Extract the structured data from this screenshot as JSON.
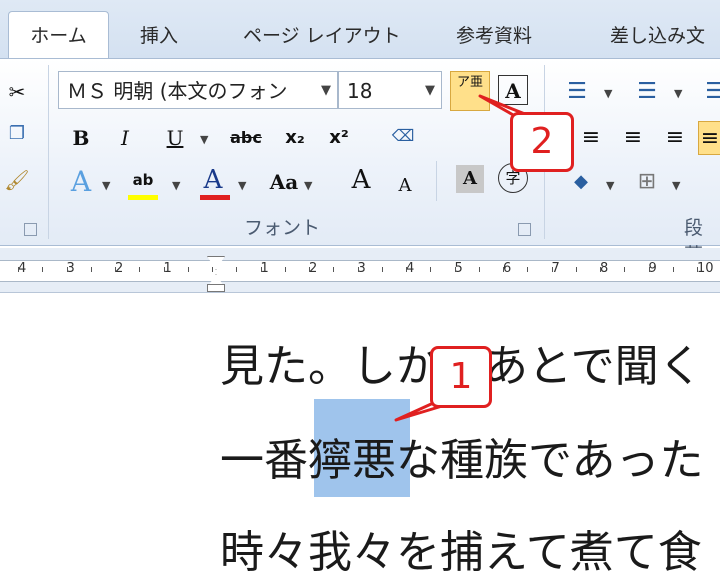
{
  "tabs": [
    "ホーム",
    "挿入",
    "ページ レイアウト",
    "参考資料",
    "差し込み文"
  ],
  "font": {
    "name": "ＭＳ 明朝 (本文のフォン",
    "size": "18",
    "phonetic_button": "ア亜",
    "charborder_button": "A"
  },
  "format_buttons": {
    "bold": "B",
    "italic": "I",
    "underline": "U",
    "strike": "abc",
    "subscript": "x₂",
    "superscript": "x²",
    "grow": "A",
    "shrink": "A",
    "change_case": "Aa",
    "shading": "A",
    "enclose": "字"
  },
  "group_labels": {
    "font": "フォント",
    "paragraph": "段落"
  },
  "ruler_numbers": [
    "4",
    "3",
    "2",
    "1",
    "1",
    "2",
    "3",
    "4",
    "5",
    "6",
    "7",
    "8",
    "9",
    "10"
  ],
  "document_lines": [
    "見た。しかしあとで聞く",
    "一番獰悪な種族であった",
    "時々我々を捕えて煮て食"
  ],
  "callouts": {
    "first": "1",
    "second": "2"
  },
  "colors": {
    "callout": "#e02020",
    "selection": "#9fc4ec",
    "highlight": "#ffff00",
    "font_color": "#e02020"
  }
}
